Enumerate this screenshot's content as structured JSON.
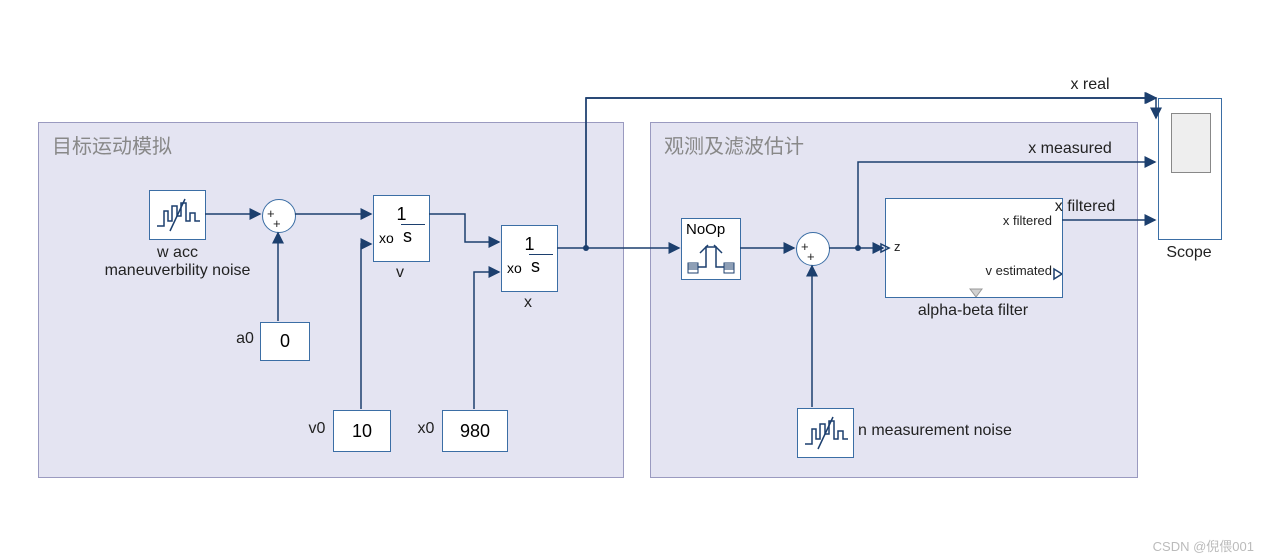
{
  "area1_title": "目标运动模拟",
  "area2_title": "观测及滤波估计",
  "noise1_label": "w acc\nmaneuverbility noise",
  "a0_label": "a0",
  "a0_value": "0",
  "v0_label": "v0",
  "v0_value": "10",
  "x0_label": "x0",
  "x0_value": "980",
  "int1_num": "1",
  "int1_den": "s",
  "int1_ic": "xo",
  "int1_label": "v",
  "int2_num": "1",
  "int2_den": "s",
  "int2_ic": "xo",
  "int2_label": "x",
  "noop_label": "NoOp",
  "noise2_label": "n measurement noise",
  "filter_in": "z",
  "filter_out1": "x filtered",
  "filter_out2": "v estimated",
  "filter_label": "alpha-beta filter",
  "sig1": "x real",
  "sig2": "x measured",
  "sig3": "x filtered",
  "scope_label": "Scope",
  "watermark": "CSDN @倪偎001"
}
